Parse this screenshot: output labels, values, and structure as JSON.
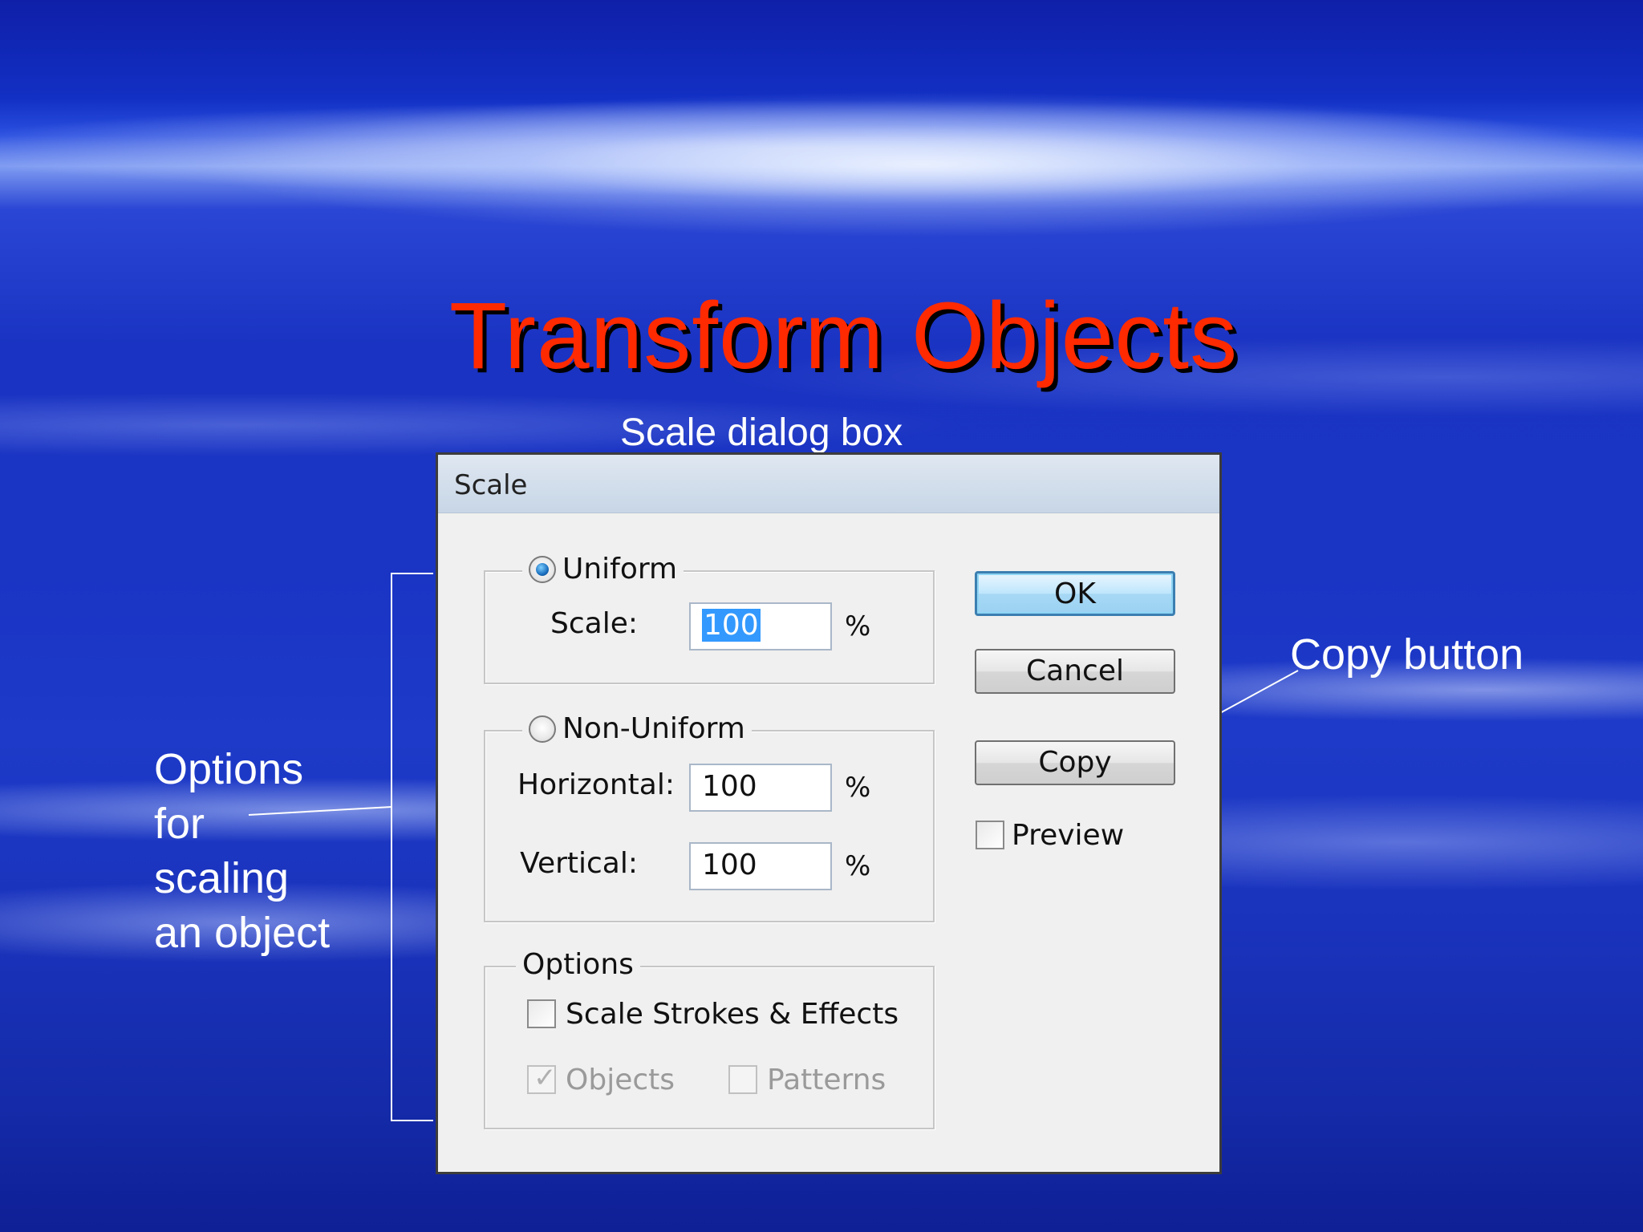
{
  "slide": {
    "title": "Transform Objects",
    "subtitle": "Scale dialog box",
    "callout_copy": "Copy button",
    "callout_options": [
      "Options",
      "for",
      "scaling",
      "an object"
    ]
  },
  "dialog": {
    "title": "Scale",
    "uniform": {
      "label": "Uniform",
      "selected": true,
      "scale_label": "Scale:",
      "scale_value": "100",
      "unit": "%"
    },
    "non_uniform": {
      "label": "Non-Uniform",
      "selected": false,
      "horizontal_label": "Horizontal:",
      "horizontal_value": "100",
      "vertical_label": "Vertical:",
      "vertical_value": "100",
      "unit": "%"
    },
    "options": {
      "label": "Options",
      "scale_strokes_label": "Scale Strokes & Effects",
      "scale_strokes_checked": false,
      "objects_label": "Objects",
      "objects_checked": true,
      "patterns_label": "Patterns",
      "patterns_checked": false
    },
    "buttons": {
      "ok": "OK",
      "cancel": "Cancel",
      "copy": "Copy"
    },
    "preview_label": "Preview",
    "preview_checked": false
  },
  "colors": {
    "title": "#ff2a00",
    "callout_text": "#ffffff"
  }
}
